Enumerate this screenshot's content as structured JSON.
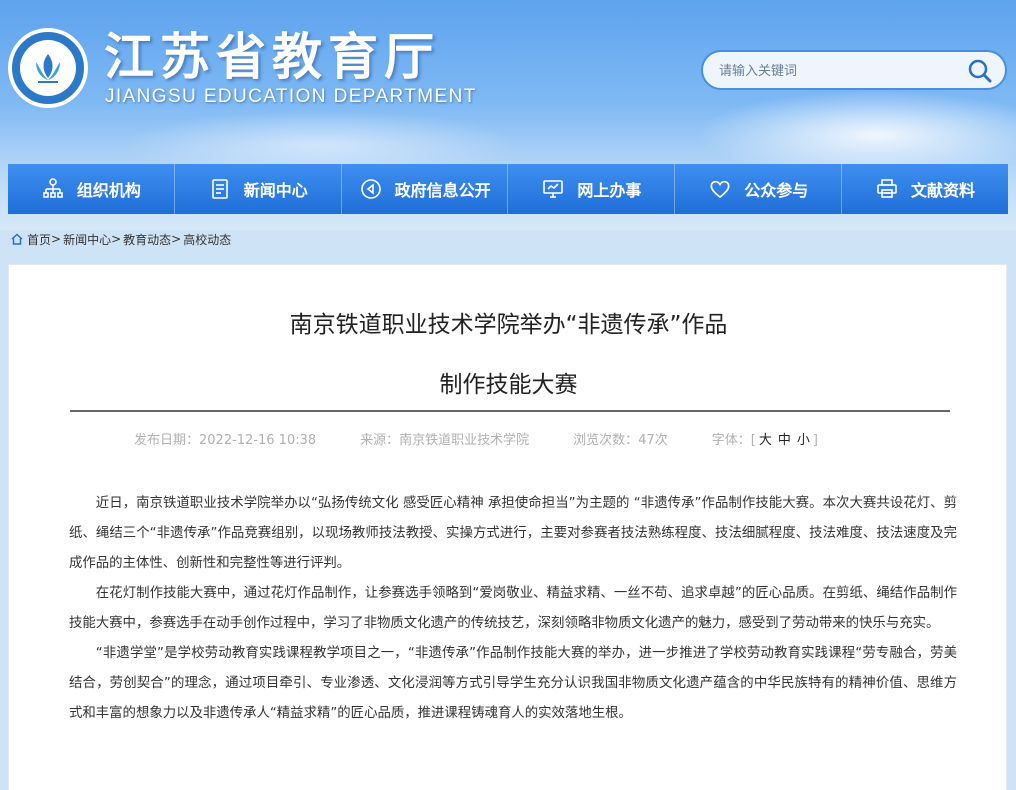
{
  "header": {
    "title": "江苏省教育厅",
    "subtitle": "JIANGSU EDUCATION DEPARTMENT",
    "search_placeholder": "请输入关键词"
  },
  "nav": {
    "items": [
      {
        "label": "组织机构",
        "icon": "org-chart-icon"
      },
      {
        "label": "新闻中心",
        "icon": "document-icon"
      },
      {
        "label": "政府信息公开",
        "icon": "megaphone-icon"
      },
      {
        "label": "网上办事",
        "icon": "monitor-icon"
      },
      {
        "label": "公众参与",
        "icon": "heart-icon"
      },
      {
        "label": "文献资料",
        "icon": "printer-icon"
      }
    ]
  },
  "breadcrumb": {
    "home": "首页",
    "items": [
      "新闻中心",
      "教育动态",
      "高校动态"
    ],
    "separator": ">"
  },
  "article": {
    "title_line1": "南京铁道职业技术学院举办“非遗传承”作品",
    "title_line2": "制作技能大赛",
    "meta": {
      "date": "发布日期：2022-12-16 10:38",
      "source": "来源：南京铁道职业技术学院",
      "views_label": "浏览次数：",
      "views": "47次",
      "font_label": "字体：",
      "font_large": "大",
      "font_medium": "中",
      "font_small": "小"
    },
    "paragraphs": [
      "近日，南京铁道职业技术学院举办以“弘扬传统文化 感受匠心精神 承担使命担当”为主题的 “非遗传承”作品制作技能大赛。本次大赛共设花灯、剪纸、绳结三个“非遗传承”作品竞赛组别，以现场教师技法教授、实操方式进行，主要对参赛者技法熟练程度、技法细腻程度、技法难度、技法速度及完成作品的主体性、创新性和完整性等进行评判。",
      "在花灯制作技能大赛中，通过花灯作品制作，让参赛选手领略到“爱岗敬业、精益求精、一丝不苟、追求卓越”的匠心品质。在剪纸、绳结作品制作技能大赛中，参赛选手在动手创作过程中，学习了非物质文化遗产的传统技艺，深刻领略非物质文化遗产的魅力，感受到了劳动带来的快乐与充实。",
      "“非遗学堂”是学校劳动教育实践课程教学项目之一，“非遗传承”作品制作技能大赛的举办，进一步推进了学校劳动教育实践课程“劳专融合，劳美结合，劳创契合”的理念，通过项目牵引、专业渗透、文化浸润等方式引导学生充分认识我国非物质文化遗产蕴含的中华民族特有的精神价值、思维方式和丰富的想象力以及非遗传承人“精益求精”的匠心品质，推进课程铸魂育人的实效落地生根。"
    ]
  },
  "colors": {
    "nav_blue": "#2a7be4",
    "header_sky": "#6aaaf0",
    "text": "#333333",
    "meta_gray": "#b0b0b0"
  }
}
